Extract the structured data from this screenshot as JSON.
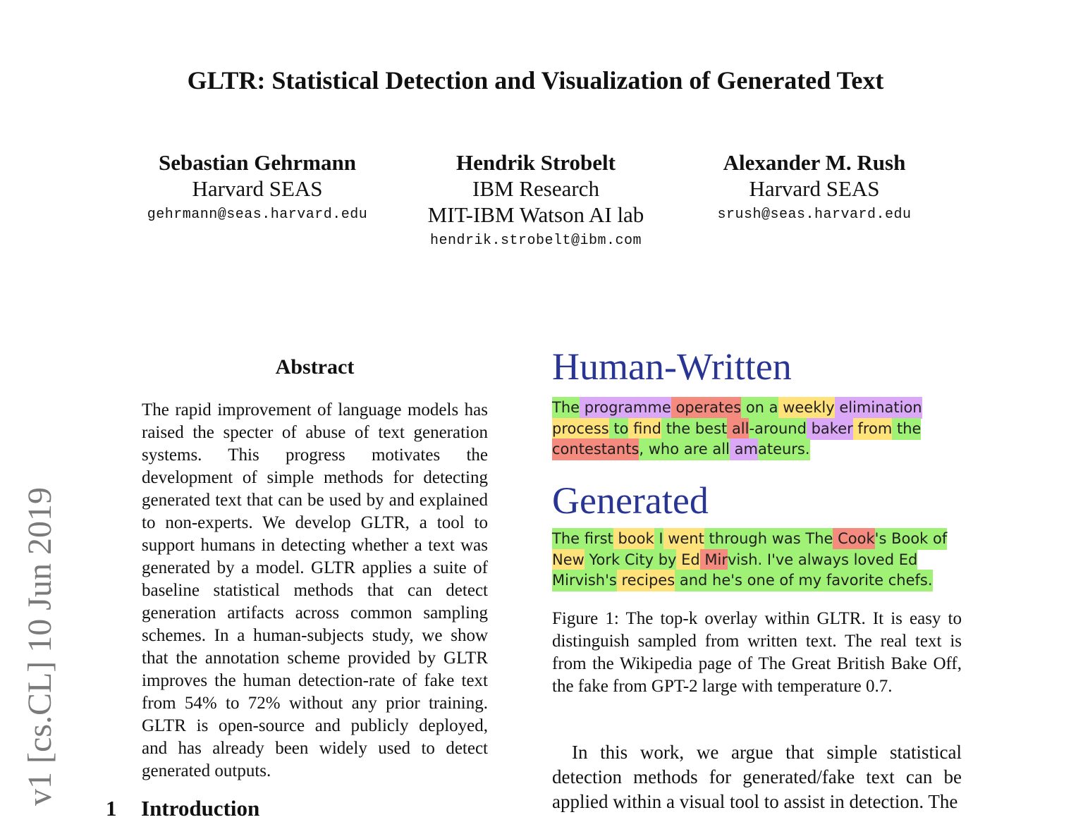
{
  "title": "GLTR: Statistical Detection and Visualization of Generated Text",
  "authors": [
    {
      "name": "Sebastian Gehrmann",
      "affiliations": [
        "Harvard SEAS"
      ],
      "email": "gehrmann@seas.harvard.edu"
    },
    {
      "name": "Hendrik Strobelt",
      "affiliations": [
        "IBM Research",
        "MIT-IBM Watson AI lab"
      ],
      "email": "hendrik.strobelt@ibm.com"
    },
    {
      "name": "Alexander M. Rush",
      "affiliations": [
        "Harvard SEAS"
      ],
      "email": "srush@seas.harvard.edu"
    }
  ],
  "arxiv_stamp": "v1  [cs.CL]  10 Jun 2019",
  "abstract": {
    "heading": "Abstract",
    "text": "The rapid improvement of language models has raised the specter of abuse of text generation systems. This progress motivates the development of simple methods for detecting generated text that can be used by and explained to non-experts. We develop GLTR, a tool to support humans in detecting whether a text was generated by a model. GLTR applies a suite of baseline statistical methods that can detect generation artifacts across common sampling schemes. In a human-subjects study, we show that the annotation scheme provided by GLTR improves the human detection-rate of fake text from 54% to 72% without any prior training. GLTR is open-source and publicly deployed, and has already been widely used to detect generated outputs."
  },
  "section": {
    "number": "1",
    "title": "Introduction"
  },
  "figure": {
    "human_heading": "Human-Written",
    "generated_heading": "Generated",
    "colors": {
      "top10": "#9ff275",
      "top100": "#ffe27a",
      "top1000": "#f58a7e",
      "rest": "#dba8f7"
    },
    "human_tokens": [
      {
        "t": "The",
        "k": "k10"
      },
      {
        "t": " programme",
        "k": "krest"
      },
      {
        "t": " operates",
        "k": "k1000"
      },
      {
        "t": " on",
        "k": "k10"
      },
      {
        "t": " a",
        "k": "k10"
      },
      {
        "t": " weekly",
        "k": "k100"
      },
      {
        "t": " elimination",
        "k": "krest"
      },
      {
        "t": " process",
        "k": "k100"
      },
      {
        "t": " to",
        "k": "k10"
      },
      {
        "t": " find",
        "k": "k100"
      },
      {
        "t": " the",
        "k": "k10"
      },
      {
        "t": " best",
        "k": "k10"
      },
      {
        "t": " all",
        "k": "k1000"
      },
      {
        "t": "-around",
        "k": "k10"
      },
      {
        "t": " baker",
        "k": "krest"
      },
      {
        "t": " from",
        "k": "k100"
      },
      {
        "t": " the",
        "k": "k10"
      },
      {
        "t": " contestants",
        "k": "k1000"
      },
      {
        "t": ",",
        "k": "k10"
      },
      {
        "t": " who",
        "k": "k10"
      },
      {
        "t": " are",
        "k": "k10"
      },
      {
        "t": " all",
        "k": "k10"
      },
      {
        "t": " am",
        "k": "krest"
      },
      {
        "t": "ateurs",
        "k": "k10"
      },
      {
        "t": ".",
        "k": "k10"
      }
    ],
    "generated_tokens": [
      {
        "t": "The",
        "k": "k10"
      },
      {
        "t": " first",
        "k": "k10"
      },
      {
        "t": " book",
        "k": "k100"
      },
      {
        "t": " I",
        "k": "k10"
      },
      {
        "t": " went",
        "k": "k100"
      },
      {
        "t": " through",
        "k": "k10"
      },
      {
        "t": " was",
        "k": "k10"
      },
      {
        "t": " The",
        "k": "k10"
      },
      {
        "t": " Cook",
        "k": "k1000"
      },
      {
        "t": "'s",
        "k": "k10"
      },
      {
        "t": " Book",
        "k": "k10"
      },
      {
        "t": " of",
        "k": "k10"
      },
      {
        "t": " New",
        "k": "k100"
      },
      {
        "t": " York",
        "k": "k10"
      },
      {
        "t": " City",
        "k": "k10"
      },
      {
        "t": " by",
        "k": "k10"
      },
      {
        "t": " Ed",
        "k": "k100"
      },
      {
        "t": " Mir",
        "k": "k1000"
      },
      {
        "t": "vish",
        "k": "k10"
      },
      {
        "t": ".",
        "k": "k10"
      },
      {
        "t": " I",
        "k": "k10"
      },
      {
        "t": "'ve",
        "k": "k10"
      },
      {
        "t": " always",
        "k": "k10"
      },
      {
        "t": " loved",
        "k": "k10"
      },
      {
        "t": " Ed",
        "k": "k10"
      },
      {
        "t": " Mirvish",
        "k": "k10"
      },
      {
        "t": "'s",
        "k": "k10"
      },
      {
        "t": " recipes",
        "k": "k100"
      },
      {
        "t": " and",
        "k": "k10"
      },
      {
        "t": " he",
        "k": "k10"
      },
      {
        "t": "'s",
        "k": "k10"
      },
      {
        "t": " one",
        "k": "k10"
      },
      {
        "t": " of",
        "k": "k10"
      },
      {
        "t": " my",
        "k": "k10"
      },
      {
        "t": " favorite",
        "k": "k10"
      },
      {
        "t": " chefs",
        "k": "k10"
      },
      {
        "t": ".",
        "k": "k10"
      }
    ],
    "caption": "Figure 1: The top-k overlay within GLTR. It is easy to distinguish sampled from written text. The real text is from the Wikipedia page of The Great British Bake Off, the fake from GPT-2 large with temperature 0.7."
  },
  "intro_text": "In this work, we argue that simple statistical detection methods for generated/fake text can be applied within a visual tool to assist in detection. The"
}
